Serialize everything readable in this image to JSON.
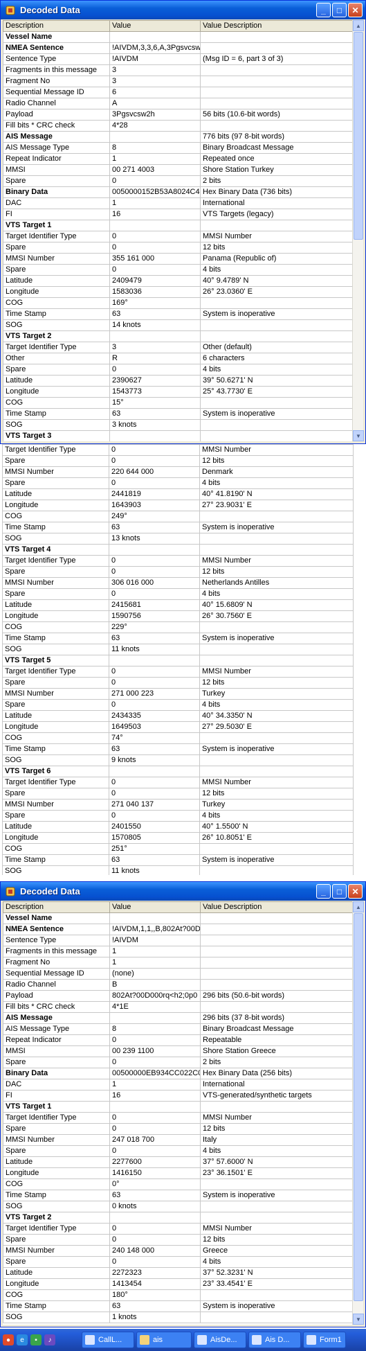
{
  "window1": {
    "title": "Decoded Data",
    "controls": {
      "minimize": "_",
      "maximize": "□",
      "close": "✕"
    },
    "columns": [
      "Description",
      "Value",
      "Value Description"
    ],
    "rows": [
      {
        "d": "Vessel Name",
        "v": "",
        "x": "",
        "h": true
      },
      {
        "d": "NMEA Sentence",
        "v": "!AIVDM,3,3,6,A,3Pgsvcsw",
        "x": "",
        "h": true
      },
      {
        "d": "Sentence Type",
        "v": "!AIVDM",
        "x": "(Msg ID = 6, part 3 of 3)"
      },
      {
        "d": "Fragments in this message",
        "v": "3",
        "x": ""
      },
      {
        "d": "Fragment No",
        "v": "3",
        "x": ""
      },
      {
        "d": "Sequential Message ID",
        "v": "6",
        "x": ""
      },
      {
        "d": "Radio Channel",
        "v": "A",
        "x": ""
      },
      {
        "d": "Payload",
        "v": "3Pgsvcsw2h",
        "x": "56 bits (10.6-bit words)"
      },
      {
        "d": "Fill bits * CRC check",
        "v": "4*28",
        "x": ""
      },
      {
        "d": "AIS Message",
        "v": "",
        "x": "776 bits (97 8-bit words)",
        "h": true
      },
      {
        "d": "AIS Message Type",
        "v": "8",
        "x": "Binary Broadcast Message"
      },
      {
        "d": "Repeat Indicator",
        "v": "1",
        "x": "Repeated once"
      },
      {
        "d": "MMSI",
        "v": "00 271 4003",
        "x": "Shore Station Turkey"
      },
      {
        "d": "Spare",
        "v": "0",
        "x": "2 bits"
      },
      {
        "d": "Binary Data",
        "v": "0050000152B53A8024C4C",
        "x": "Hex Binary Data (736 bits)",
        "h": true
      },
      {
        "d": "DAC",
        "v": "1",
        "x": "International"
      },
      {
        "d": "FI",
        "v": "16",
        "x": "VTS Targets (legacy)"
      },
      {
        "d": "VTS Target 1",
        "v": "",
        "x": "",
        "h": true
      },
      {
        "d": "Target Identifier Type",
        "v": "0",
        "x": "MMSI Number"
      },
      {
        "d": "Spare",
        "v": "0",
        "x": "12 bits"
      },
      {
        "d": "MMSI Number",
        "v": "355 161 000",
        "x": "Panama (Republic of)"
      },
      {
        "d": "Spare",
        "v": "0",
        "x": "4 bits"
      },
      {
        "d": "Latitude",
        "v": "2409479",
        "x": "40° 9.4789' N"
      },
      {
        "d": "Longitude",
        "v": "1583036",
        "x": "26° 23.0360' E"
      },
      {
        "d": "COG",
        "v": "169°",
        "x": ""
      },
      {
        "d": "Time Stamp",
        "v": "63",
        "x": "System is inoperative"
      },
      {
        "d": "SOG",
        "v": "14 knots",
        "x": ""
      },
      {
        "d": "VTS Target 2",
        "v": "",
        "x": "",
        "h": true
      },
      {
        "d": "Target Identifier Type",
        "v": "3",
        "x": "Other (default)"
      },
      {
        "d": "Other",
        "v": "R",
        "x": "6 characters"
      },
      {
        "d": "Spare",
        "v": "0",
        "x": "4 bits"
      },
      {
        "d": "Latitude",
        "v": "2390627",
        "x": "39° 50.6271' N"
      },
      {
        "d": "Longitude",
        "v": "1543773",
        "x": "25° 43.7730' E"
      },
      {
        "d": "COG",
        "v": "15°",
        "x": ""
      },
      {
        "d": "Time Stamp",
        "v": "63",
        "x": "System is inoperative"
      },
      {
        "d": "SOG",
        "v": "3 knots",
        "x": ""
      },
      {
        "d": "VTS Target 3",
        "v": "",
        "x": "",
        "h": true
      }
    ]
  },
  "middle": {
    "rows": [
      {
        "d": "Target Identifier Type",
        "v": "0",
        "x": "MMSI Number"
      },
      {
        "d": "Spare",
        "v": "0",
        "x": "12 bits"
      },
      {
        "d": "MMSI Number",
        "v": "220 644 000",
        "x": "Denmark"
      },
      {
        "d": "Spare",
        "v": "0",
        "x": "4 bits"
      },
      {
        "d": "Latitude",
        "v": "2441819",
        "x": "40° 41.8190' N"
      },
      {
        "d": "Longitude",
        "v": "1643903",
        "x": "27° 23.9031' E"
      },
      {
        "d": "COG",
        "v": "249°",
        "x": ""
      },
      {
        "d": "Time Stamp",
        "v": "63",
        "x": "System is inoperative"
      },
      {
        "d": "SOG",
        "v": "13 knots",
        "x": ""
      },
      {
        "d": "VTS Target 4",
        "v": "",
        "x": "",
        "h": true
      },
      {
        "d": "Target Identifier Type",
        "v": "0",
        "x": "MMSI Number"
      },
      {
        "d": "Spare",
        "v": "0",
        "x": "12 bits"
      },
      {
        "d": "MMSI Number",
        "v": "306 016 000",
        "x": "Netherlands Antilles"
      },
      {
        "d": "Spare",
        "v": "0",
        "x": "4 bits"
      },
      {
        "d": "Latitude",
        "v": "2415681",
        "x": "40° 15.6809' N"
      },
      {
        "d": "Longitude",
        "v": "1590756",
        "x": "26° 30.7560' E"
      },
      {
        "d": "COG",
        "v": "229°",
        "x": ""
      },
      {
        "d": "Time Stamp",
        "v": "63",
        "x": "System is inoperative"
      },
      {
        "d": "SOG",
        "v": "11 knots",
        "x": ""
      },
      {
        "d": "VTS Target 5",
        "v": "",
        "x": "",
        "h": true
      },
      {
        "d": "Target Identifier Type",
        "v": "0",
        "x": "MMSI Number"
      },
      {
        "d": "Spare",
        "v": "0",
        "x": "12 bits"
      },
      {
        "d": "MMSI Number",
        "v": "271 000 223",
        "x": "Turkey"
      },
      {
        "d": "Spare",
        "v": "0",
        "x": "4 bits"
      },
      {
        "d": "Latitude",
        "v": "2434335",
        "x": "40° 34.3350' N"
      },
      {
        "d": "Longitude",
        "v": "1649503",
        "x": "27° 29.5030' E"
      },
      {
        "d": "COG",
        "v": "74°",
        "x": ""
      },
      {
        "d": "Time Stamp",
        "v": "63",
        "x": "System is inoperative"
      },
      {
        "d": "SOG",
        "v": "9 knots",
        "x": ""
      },
      {
        "d": "VTS Target 6",
        "v": "",
        "x": "",
        "h": true
      },
      {
        "d": "Target Identifier Type",
        "v": "0",
        "x": "MMSI Number"
      },
      {
        "d": "Spare",
        "v": "0",
        "x": "12 bits"
      },
      {
        "d": "MMSI Number",
        "v": "271 040 137",
        "x": "Turkey"
      },
      {
        "d": "Spare",
        "v": "0",
        "x": "4 bits"
      },
      {
        "d": "Latitude",
        "v": "2401550",
        "x": "40° 1.5500' N"
      },
      {
        "d": "Longitude",
        "v": "1570805",
        "x": "26° 10.8051' E"
      },
      {
        "d": "COG",
        "v": "251°",
        "x": ""
      },
      {
        "d": "Time Stamp",
        "v": "63",
        "x": "System is inoperative"
      },
      {
        "d": "SOG",
        "v": "11 knots",
        "x": ""
      }
    ]
  },
  "window2": {
    "title": "Decoded Data",
    "controls": {
      "minimize": "_",
      "maximize": "□",
      "close": "✕"
    },
    "columns": [
      "Description",
      "Value",
      "Value Description"
    ],
    "rows": [
      {
        "d": "Vessel Name",
        "v": "",
        "x": "",
        "h": true
      },
      {
        "d": "NMEA Sentence",
        "v": "!AIVDM,1,1,,B,802At?00D",
        "x": "",
        "h": true
      },
      {
        "d": "Sentence Type",
        "v": "!AIVDM",
        "x": ""
      },
      {
        "d": "Fragments in this message",
        "v": "1",
        "x": ""
      },
      {
        "d": "Fragment No",
        "v": "1",
        "x": ""
      },
      {
        "d": "Sequential Message ID",
        "v": "(none)",
        "x": ""
      },
      {
        "d": "Radio Channel",
        "v": "B",
        "x": ""
      },
      {
        "d": "Payload",
        "v": "802At?00D000rq<h2;0p0",
        "x": "296 bits (50.6-bit words)"
      },
      {
        "d": "Fill bits * CRC check",
        "v": "4*1E",
        "x": ""
      },
      {
        "d": "AIS Message",
        "v": "",
        "x": "296 bits (37 8-bit words)",
        "h": true
      },
      {
        "d": "AIS Message Type",
        "v": "8",
        "x": "Binary Broadcast Message"
      },
      {
        "d": "Repeat Indicator",
        "v": "0",
        "x": "Repeatable"
      },
      {
        "d": "MMSI",
        "v": "00 239 1100",
        "x": "Shore Station Greece"
      },
      {
        "d": "Spare",
        "v": "0",
        "x": "2 bits"
      },
      {
        "d": "Binary Data",
        "v": "00500000EB934CC022C0I",
        "x": "Hex Binary Data (256 bits)",
        "h": true
      },
      {
        "d": "DAC",
        "v": "1",
        "x": "International"
      },
      {
        "d": "FI",
        "v": "16",
        "x": "VTS-generated/synthetic targets"
      },
      {
        "d": "VTS Target 1",
        "v": "",
        "x": "",
        "h": true
      },
      {
        "d": "Target Identifier Type",
        "v": "0",
        "x": "MMSI Number"
      },
      {
        "d": "Spare",
        "v": "0",
        "x": "12 bits"
      },
      {
        "d": "MMSI Number",
        "v": "247 018 700",
        "x": "Italy"
      },
      {
        "d": "Spare",
        "v": "0",
        "x": "4 bits"
      },
      {
        "d": "Latitude",
        "v": "2277600",
        "x": "37° 57.6000' N"
      },
      {
        "d": "Longitude",
        "v": "1416150",
        "x": "23° 36.1501' E"
      },
      {
        "d": "COG",
        "v": "0°",
        "x": ""
      },
      {
        "d": "Time Stamp",
        "v": "63",
        "x": "System is inoperative"
      },
      {
        "d": "SOG",
        "v": "0 knots",
        "x": ""
      },
      {
        "d": "VTS Target 2",
        "v": "",
        "x": "",
        "h": true
      },
      {
        "d": "Target Identifier Type",
        "v": "0",
        "x": "MMSI Number"
      },
      {
        "d": "Spare",
        "v": "0",
        "x": "12 bits"
      },
      {
        "d": "MMSI Number",
        "v": "240 148 000",
        "x": "Greece"
      },
      {
        "d": "Spare",
        "v": "0",
        "x": "4 bits"
      },
      {
        "d": "Latitude",
        "v": "2272323",
        "x": "37° 52.3231' N"
      },
      {
        "d": "Longitude",
        "v": "1413454",
        "x": "23° 33.4541' E"
      },
      {
        "d": "COG",
        "v": "180°",
        "x": ""
      },
      {
        "d": "Time Stamp",
        "v": "63",
        "x": "System is inoperative"
      },
      {
        "d": "SOG",
        "v": "1 knots",
        "x": ""
      }
    ]
  },
  "taskbar": {
    "tasks": [
      "CallL...",
      "ais",
      "AisDe...",
      "Ais D...",
      "Form1"
    ]
  },
  "colors": {
    "titlebar": "#0a5fd8",
    "taskbar": "#245edb",
    "close": "#c8411b"
  }
}
